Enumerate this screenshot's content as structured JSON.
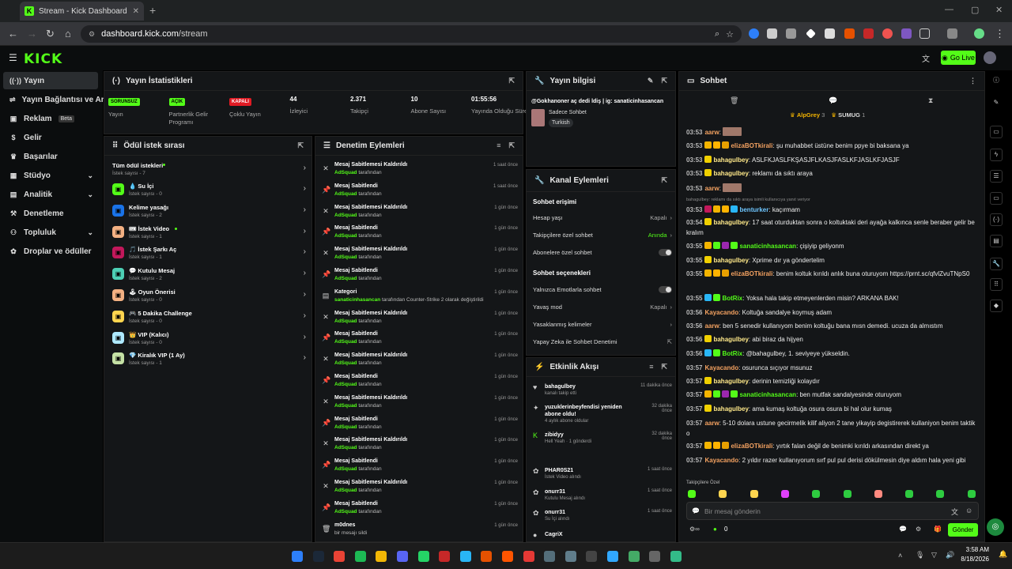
{
  "browser": {
    "tab_title": "Stream - Kick Dashboard",
    "url_host": "dashboard.kick.com",
    "url_path": "/stream"
  },
  "header": {
    "logo": "KICK",
    "go_live": "Go Live"
  },
  "sidebar": {
    "items": [
      {
        "label": "Yayın",
        "icon": "broadcast-icon",
        "active": true
      },
      {
        "label": "Yayın Bağlantısı ve Anahtarı",
        "icon": "link-icon"
      },
      {
        "label": "Reklam",
        "icon": "ad-icon",
        "badge": "Beta"
      },
      {
        "label": "Gelir",
        "icon": "dollar-icon"
      },
      {
        "label": "Başarılar",
        "icon": "trophy-icon"
      },
      {
        "label": "Stüdyo",
        "icon": "studio-icon",
        "chevron": true
      },
      {
        "label": "Analitik",
        "icon": "chart-icon",
        "chevron": true
      },
      {
        "label": "Denetleme",
        "icon": "hammer-icon"
      },
      {
        "label": "Topluluk",
        "icon": "people-icon",
        "chevron": true
      },
      {
        "label": "Droplar ve ödüller",
        "icon": "gift-icon"
      }
    ]
  },
  "stats": {
    "title": "Yayın İstatistikleri",
    "items": [
      {
        "badge": "SORUNSUZ",
        "badge_color": "#53fc18",
        "label": "Yayın"
      },
      {
        "badge": "AÇIK",
        "badge_color": "#53fc18",
        "label": "Partnerlik Gelir Programı"
      },
      {
        "badge": "KAPALI",
        "badge_color": "#e01b24",
        "label": "Çoklu Yayın"
      },
      {
        "value": "44",
        "label": "İzleyici"
      },
      {
        "value": "2.371",
        "label": "Takipçi"
      },
      {
        "value": "10",
        "label": "Abone Sayısı"
      },
      {
        "value": "01:55:56",
        "label": "Yayında Olduğu Süre"
      }
    ]
  },
  "info": {
    "title": "Yayın bilgisi",
    "stream_title": "@Gokhanoner aç dedi ldiş | ig: sanaticinhasancan",
    "category": "Sadece Sohbet",
    "tag": "Turkish"
  },
  "queue": {
    "title": "Ödül istek sırası",
    "all_label": "Tüm ödül istekleri",
    "all_sub": "İstek sayısı - 7",
    "items": [
      {
        "name": "💧 Su İçi",
        "sub": "İstek sayısı - 0",
        "color": "#53fc18"
      },
      {
        "name": "Kelime yasağı",
        "sub": "İstek sayısı - 2",
        "color": "#1a73e8"
      },
      {
        "name": "🎟 İstek Video",
        "sub": "İstek sayısı - 1",
        "color": "#f4b183",
        "dot": true
      },
      {
        "name": "🎵 İstek Şarkı Aç",
        "sub": "İstek sayısı - 1",
        "color": "#c2185b"
      },
      {
        "name": "💬 Kutulu Mesaj",
        "sub": "İstek sayısı - 2",
        "color": "#4dd0b5"
      },
      {
        "name": "🕹 Oyun Önerisi",
        "sub": "İstek sayısı - 0",
        "color": "#f4b183"
      },
      {
        "name": "🎮 5 Dakika Challenge",
        "sub": "İstek sayısı - 0",
        "color": "#ffd54f"
      },
      {
        "name": "👑 VIP (Kalıcı)",
        "sub": "İstek sayısı - 0",
        "color": "#aee9ff"
      },
      {
        "name": "💎 Kiralık VIP (1 Ay)",
        "sub": "İstek sayısı - 1",
        "color": "#c5e1a5"
      }
    ]
  },
  "mod": {
    "title": "Denetim Eylemleri",
    "items": [
      {
        "icon": "unpin-icon",
        "title": "Mesaj Sabitlemesi Kaldırıldı",
        "by": "AdSquad",
        "suffix": " tarafından",
        "time": "1 saat önce"
      },
      {
        "icon": "pin-icon",
        "title": "Mesaj Sabitlendi",
        "by": "AdSquad",
        "suffix": " tarafından",
        "time": "1 saat önce"
      },
      {
        "icon": "unpin-icon",
        "title": "Mesaj Sabitlemesi Kaldırıldı",
        "by": "AdSquad",
        "suffix": " tarafından",
        "time": "1 gün önce"
      },
      {
        "icon": "pin-icon",
        "title": "Mesaj Sabitlendi",
        "by": "AdSquad",
        "suffix": " tarafından",
        "time": "1 gün önce"
      },
      {
        "icon": "unpin-icon",
        "title": "Mesaj Sabitlemesi Kaldırıldı",
        "by": "AdSquad",
        "suffix": " tarafından",
        "time": "1 gün önce"
      },
      {
        "icon": "pin-icon",
        "title": "Mesaj Sabitlendi",
        "by": "AdSquad",
        "suffix": " tarafından",
        "time": "1 gün önce"
      },
      {
        "icon": "category-icon",
        "title": "Kategori",
        "by": "sanaticinhasancan",
        "suffix": " tarafından Counter-Strike 2 olarak değiştirildi",
        "time": "1 gün önce"
      },
      {
        "icon": "unpin-icon",
        "title": "Mesaj Sabitlemesi Kaldırıldı",
        "by": "AdSquad",
        "suffix": " tarafından",
        "time": "1 gün önce"
      },
      {
        "icon": "pin-icon",
        "title": "Mesaj Sabitlendi",
        "by": "AdSquad",
        "suffix": " tarafından",
        "time": "1 gün önce"
      },
      {
        "icon": "unpin-icon",
        "title": "Mesaj Sabitlemesi Kaldırıldı",
        "by": "AdSquad",
        "suffix": " tarafından",
        "time": "1 gün önce"
      },
      {
        "icon": "pin-icon",
        "title": "Mesaj Sabitlendi",
        "by": "AdSquad",
        "suffix": " tarafından",
        "time": "1 gün önce"
      },
      {
        "icon": "unpin-icon",
        "title": "Mesaj Sabitlemesi Kaldırıldı",
        "by": "AdSquad",
        "suffix": " tarafından",
        "time": "1 gün önce"
      },
      {
        "icon": "pin-icon",
        "title": "Mesaj Sabitlendi",
        "by": "AdSquad",
        "suffix": " tarafından",
        "time": "1 gün önce"
      },
      {
        "icon": "unpin-icon",
        "title": "Mesaj Sabitlemesi Kaldırıldı",
        "by": "AdSquad",
        "suffix": " tarafından",
        "time": "1 gün önce"
      },
      {
        "icon": "pin-icon",
        "title": "Mesaj Sabitlendi",
        "by": "AdSquad",
        "suffix": " tarafından",
        "time": "1 gün önce"
      },
      {
        "icon": "unpin-icon",
        "title": "Mesaj Sabitlemesi Kaldırıldı",
        "by": "AdSquad",
        "suffix": " tarafından",
        "time": "1 gün önce"
      },
      {
        "icon": "pin-icon",
        "title": "Mesaj Sabitlendi",
        "by": "AdSquad",
        "suffix": " tarafından",
        "time": "1 gün önce"
      },
      {
        "icon": "trash-icon",
        "title": "m0dnes",
        "by": "",
        "suffix": "bir mesajı sildi",
        "time": "1 gün önce"
      }
    ]
  },
  "channel": {
    "title": "Kanal Eylemleri",
    "access_title": "Sohbet erişimi",
    "rows1": [
      {
        "label": "Hesap yaşı",
        "value": "Kapalı",
        "type": "chev"
      },
      {
        "label": "Takipçilere özel sohbet",
        "value": "Anında",
        "type": "chev",
        "green": true
      },
      {
        "label": "Abonelere özel sohbet",
        "value": "",
        "type": "toggle"
      }
    ],
    "options_title": "Sohbet seçenekleri",
    "rows2": [
      {
        "label": "Yalnızca Emotlarla sohbet",
        "value": "",
        "type": "toggle"
      },
      {
        "label": "Yavaş mod",
        "value": "Kapalı",
        "type": "chev"
      },
      {
        "label": "Yasaklanmış kelimeler",
        "value": "",
        "type": "chev"
      },
      {
        "label": "Yapay Zeka ile Sohbet Denetimi",
        "value": "",
        "type": "ext"
      }
    ]
  },
  "activity": {
    "title": "Etkinlik Akışı",
    "items": [
      {
        "icon": "heart-icon",
        "name": "bahagulbey",
        "sub": "kanalı takip etti",
        "time": "11 dakika önce"
      },
      {
        "icon": "star-icon",
        "name": "yuzuklerinbeyfendisi yeniden abone oldu!",
        "sub": "4 aylık abone oldular",
        "time": "32 dakika önce"
      },
      {
        "icon": "kick-icon",
        "name": "zibidyy",
        "sub": "Hell Yeah · 1 gönderdi",
        "time": "32 dakika önce"
      },
      {
        "icon": "gift-icon",
        "name": "PHAR0S21",
        "sub": "İstek Video alındı",
        "time": "1 saat önce"
      },
      {
        "icon": "gift-icon",
        "name": "onurr31",
        "sub": "Kutulu Mesaj alındı",
        "time": "1 saat önce"
      },
      {
        "icon": "gift-icon",
        "name": "onurr31",
        "sub": "Su İçi alındı",
        "time": "1 saat önce"
      },
      {
        "icon": "user-icon",
        "name": "CagriX",
        "sub": "",
        "time": ""
      }
    ]
  },
  "chat": {
    "title": "Sohbet",
    "top": [
      {
        "name": "AlpGrey",
        "count": "3"
      },
      {
        "name": "SUMUG",
        "count": "1"
      }
    ],
    "reply_hint": "bahagulbey: reklamı da sıktı araya isimli kullanıcıya yanıt veriyor",
    "messages": [
      {
        "ts": "03:53",
        "name": "aarw",
        "color": "#f4a261",
        "text": "",
        "emote": true
      },
      {
        "ts": "03:53",
        "name": "elizaBOTkirali",
        "color": "#f4a261",
        "text": "şu muhabbet üstüne benim ppye bi baksana ya",
        "badges": [
          "#f4b400",
          "#ffb300",
          "#e8a000"
        ]
      },
      {
        "ts": "03:53",
        "name": "bahagulbey",
        "color": "#ffe98a",
        "text": "ASLFKJASLFKŞASJFLKASJFASLKFJASLKFJASJF",
        "badges": [
          "#f0d000"
        ]
      },
      {
        "ts": "03:53",
        "name": "bahagulbey",
        "color": "#ffe98a",
        "text": "reklamı da sıktı araya",
        "badges": [
          "#f0d000"
        ]
      },
      {
        "ts": "03:53",
        "name": "aarw",
        "color": "#f4a261",
        "text": "",
        "emote": true
      },
      {
        "ts": "03:53",
        "name": "benturker",
        "color": "#6ec6ff",
        "text": "kaçırmam",
        "badges": [
          "#c2185b",
          "#f4b400",
          "#ffb300",
          "#29b6f6"
        ]
      },
      {
        "ts": "03:54",
        "name": "bahagulbey",
        "color": "#ffe98a",
        "text": "17 saat oturduktan sonra o koltuktaki deri ayağa kalkınca senle beraber gelir be kralım",
        "badges": [
          "#f0d000"
        ]
      },
      {
        "ts": "03:55",
        "name": "sanaticinhasancan",
        "color": "#53fc18",
        "text": "çişiyip geliyonm",
        "badges": [
          "#f4b400",
          "#53fc18",
          "#9c27b0",
          "#53fc18"
        ]
      },
      {
        "ts": "03:55",
        "name": "bahagulbey",
        "color": "#ffe98a",
        "text": "Xprime dır ya göndertelim",
        "badges": [
          "#f0d000"
        ]
      },
      {
        "ts": "03:55",
        "name": "elizaBOTkirali",
        "color": "#f4a261",
        "text": "benim koltuk kırıldı anlık buna oturuyom https://prnt.sc/qfvlZvuTNpS0",
        "badges": [
          "#f4b400",
          "#ffb300",
          "#e8a000"
        ]
      },
      {
        "ts": "03:55",
        "name": "BotRix",
        "color": "#53fc18",
        "text": "Yoksa hala takip etmeyenlerden misin? ARKANA BAK!",
        "badges": [
          "#29b6f6",
          "#53fc18"
        ]
      },
      {
        "ts": "03:56",
        "name": "Kayacando",
        "color": "#f4a261",
        "text": "Koltuğa sandalye koymuş adam"
      },
      {
        "ts": "03:56",
        "name": "aarw",
        "color": "#f4a261",
        "text": "ben 5 senedir kullanıyom benim koltuğu bana mısn demedi. ucuza da almıstım"
      },
      {
        "ts": "03:56",
        "name": "bahagulbey",
        "color": "#ffe98a",
        "text": "abi biraz da hijyen",
        "badges": [
          "#f0d000"
        ]
      },
      {
        "ts": "03:56",
        "name": "BotRix",
        "color": "#53fc18",
        "text": "@bahagulbey, 1. seviyeye yükseldin.",
        "badges": [
          "#29b6f6",
          "#53fc18"
        ]
      },
      {
        "ts": "03:57",
        "name": "Kayacando",
        "color": "#f4a261",
        "text": "osurunca sıçıyor msunuz"
      },
      {
        "ts": "03:57",
        "name": "bahagulbey",
        "color": "#ffe98a",
        "text": "derinin temizliği kolaydır",
        "badges": [
          "#f0d000"
        ]
      },
      {
        "ts": "03:57",
        "name": "sanaticinhasancan",
        "color": "#53fc18",
        "text": "ben mutfak sandalyesinde oturuyom",
        "badges": [
          "#f4b400",
          "#53fc18",
          "#9c27b0",
          "#53fc18"
        ]
      },
      {
        "ts": "03:57",
        "name": "bahagulbey",
        "color": "#ffe98a",
        "text": "ama kumaş koltuğa osura osura bi hal olur kumaş",
        "badges": [
          "#f0d000"
        ]
      },
      {
        "ts": "03:57",
        "name": "aarw",
        "color": "#f4a261",
        "text": "5-10 dolara ustune gecirmelik kilif aliyon 2 tane yikayip degistirerek kullaniyon benim taktik o"
      },
      {
        "ts": "03:57",
        "name": "elizaBOTkirali",
        "color": "#f4a261",
        "text": "yırtık falan değil de benimki kırıldı arkasından direkt ya",
        "badges": [
          "#f4b400",
          "#ffb300",
          "#e8a000"
        ]
      },
      {
        "ts": "03:57",
        "name": "Kayacando",
        "color": "#f4a261",
        "text": "2 yıldır razer kullanıyorum sırf pul pul derisi dökülmesin diye aldım hala yeni gibi"
      }
    ],
    "followers_only": "Takipçilere Özel",
    "input_placeholder": "Bir mesaj gönderin",
    "points": "0",
    "send": "Gönder"
  },
  "taskbar": {
    "time": "3:58 AM",
    "date": "8/18/2026"
  }
}
